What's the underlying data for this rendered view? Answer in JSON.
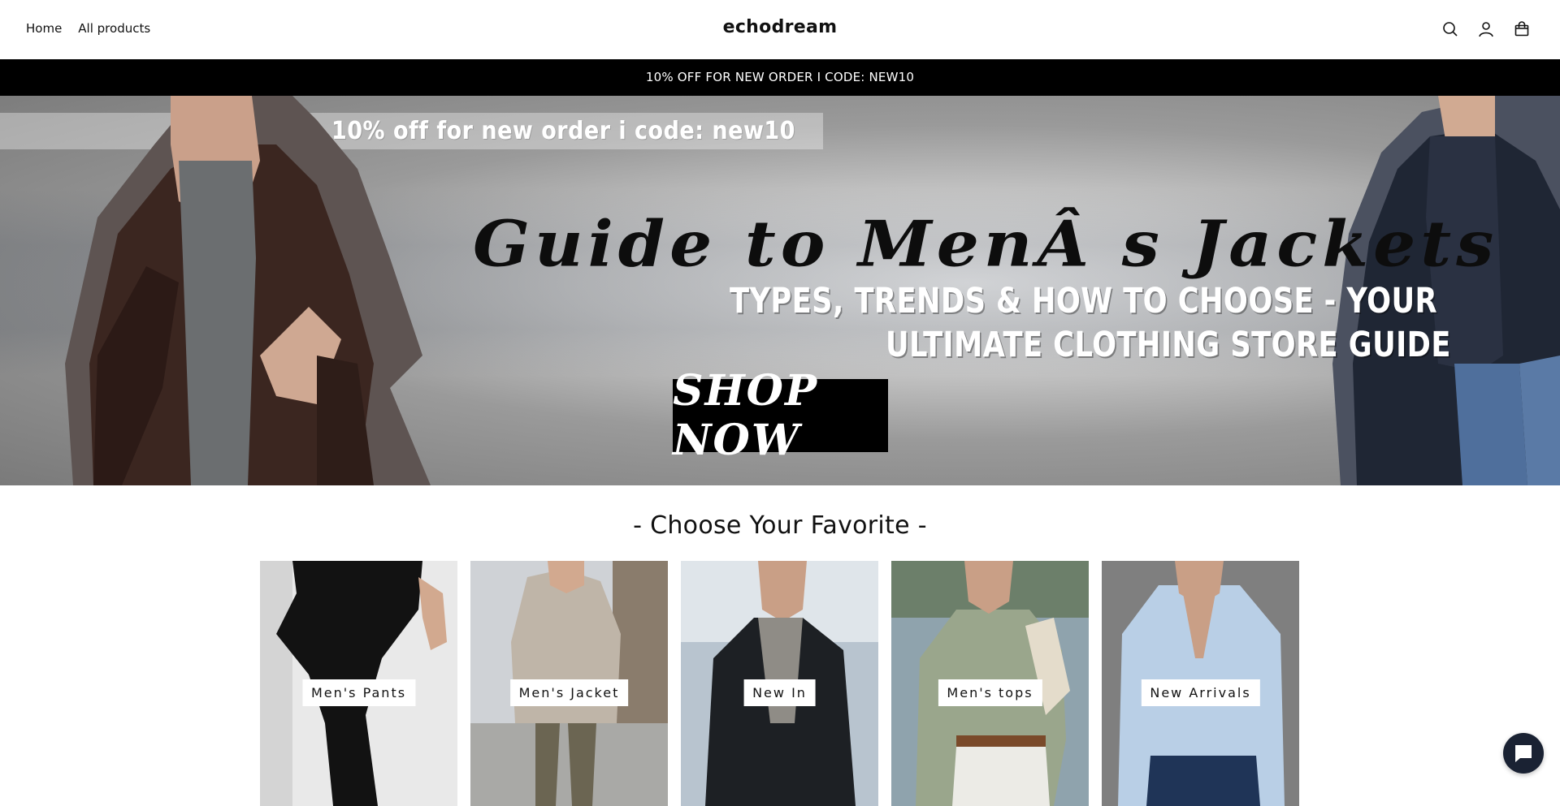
{
  "header": {
    "nav": [
      {
        "label": "Home"
      },
      {
        "label": "All products"
      }
    ],
    "brand": "echodream",
    "icons": [
      "search-icon",
      "account-icon",
      "cart-icon"
    ]
  },
  "announcement": {
    "text": "10% OFF FOR NEW ORDER I CODE: NEW10"
  },
  "hero": {
    "promo": "10% off for new order i code: new10",
    "title": "Guide to MenÂ  s Jackets",
    "subtitle_line1": "TYPES, TRENDS & HOW TO CHOOSE - YOUR",
    "subtitle_line2": "ULTIMATE CLOTHING STORE GUIDE",
    "cta": "SHOP NOW"
  },
  "collections": {
    "title": "- Choose Your Favorite -",
    "items": [
      {
        "label": "Men's Pants"
      },
      {
        "label": "Men's Jacket"
      },
      {
        "label": "New In"
      },
      {
        "label": "Men's tops"
      },
      {
        "label": "New Arrivals"
      }
    ]
  },
  "colors": {
    "announcement_bg": "#000000",
    "chat_bg": "#1a2233"
  }
}
